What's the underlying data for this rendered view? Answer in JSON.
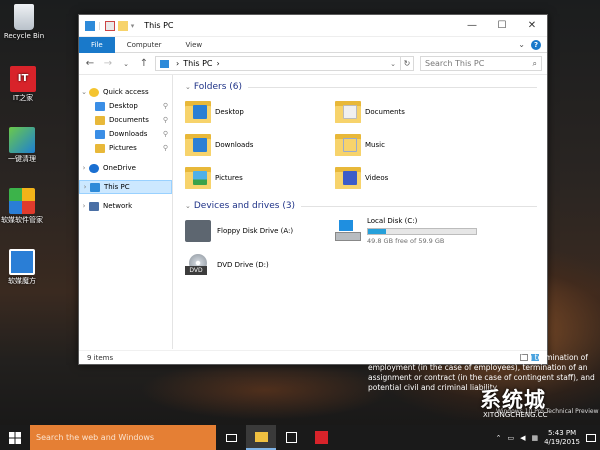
{
  "desktop": {
    "icons": [
      {
        "label": "Recycle Bin",
        "color": "#c7ced6"
      },
      {
        "label": "IT之家",
        "color": "#d8232a"
      },
      {
        "label": "一键清理",
        "color": "#2e9b3c"
      },
      {
        "label": "软媒软件管家",
        "color": "#f2b319"
      },
      {
        "label": "软媒魔方",
        "color": "#2a7ed6"
      }
    ]
  },
  "window": {
    "title": "This PC",
    "ribbon_tabs": [
      "File",
      "Computer",
      "View"
    ],
    "address": {
      "segment": "This PC",
      "separator": "›"
    },
    "search_placeholder": "Search This PC",
    "nav_pane": [
      {
        "label": "Quick access",
        "icon": "star-icon",
        "color": "#f4c430"
      },
      {
        "label": "Desktop",
        "icon": "folder-icon",
        "color": "#3a8ee6",
        "pinned": true
      },
      {
        "label": "Documents",
        "icon": "folder-icon",
        "color": "#e8b839",
        "pinned": true
      },
      {
        "label": "Downloads",
        "icon": "folder-icon",
        "color": "#3a8ee6",
        "pinned": true
      },
      {
        "label": "Pictures",
        "icon": "folder-icon",
        "color": "#e8b839",
        "pinned": true
      },
      {
        "label": "OneDrive",
        "icon": "cloud-icon",
        "color": "#1a6fd1"
      },
      {
        "label": "This PC",
        "icon": "computer-icon",
        "color": "#2d8ad9",
        "selected": true
      },
      {
        "label": "Network",
        "icon": "network-icon",
        "color": "#4a6fa5"
      }
    ],
    "folders_header": "Folders (6)",
    "folders": [
      {
        "label": "Desktop",
        "emblem": "#2b7fd4"
      },
      {
        "label": "Documents",
        "emblem": "#f0f0f0"
      },
      {
        "label": "Downloads",
        "emblem": "#2b7fd4"
      },
      {
        "label": "Music",
        "emblem": "#f7d36b"
      },
      {
        "label": "Pictures",
        "emblem": "#4fb0e8"
      },
      {
        "label": "Videos",
        "emblem": "#3c5cc9"
      }
    ],
    "drives_header": "Devices and drives (3)",
    "drives": [
      {
        "label": "Floppy Disk Drive (A:)"
      },
      {
        "label": "Local Disk (C:)",
        "sub": "49.8 GB free of 59.9 GB",
        "used_fraction": 0.17
      },
      {
        "label": "DVD Drive (D:)",
        "badge": "DVD"
      }
    ],
    "status": "9 items"
  },
  "legal_text": "alt in disciplinary action up to and including termination of employment (in the case of employees), termination of an assignment or contract (in the case of contingent staff), and potential civil and criminal liability.",
  "watermark": {
    "brand": "系统城",
    "url": "XITONGCHENG.CC"
  },
  "windows_version_text": "Windows 10 Pro Technical Preview",
  "taskbar": {
    "search_placeholder": "Search the web and Windows",
    "time": "5:43 PM",
    "date": "4/19/2015"
  }
}
